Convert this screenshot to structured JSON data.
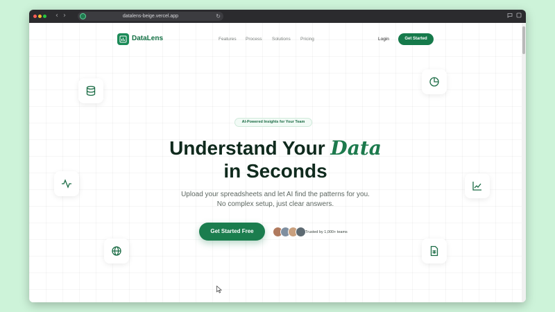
{
  "browser": {
    "url": "datalens-beige.vercel.app"
  },
  "nav": {
    "brand": "DataLens",
    "links": [
      "Features",
      "Process",
      "Solutions",
      "Pricing"
    ],
    "login": "Login",
    "cta": "Get Started"
  },
  "hero": {
    "badge": "AI-Powered Insights for Your Team",
    "title_part1": "Understand Your",
    "title_accent": "Data",
    "title_part2": "in Seconds",
    "subtitle": "Upload your spreadsheets and let AI find the patterns for you. No complex setup, just clear answers.",
    "cta": "Get Started Free",
    "trust": "Trusted by 1,000+ teams"
  },
  "floating_icons": [
    "database-icon",
    "pie-chart-icon",
    "activity-icon",
    "line-chart-icon",
    "globe-icon",
    "spreadsheet-icon"
  ],
  "colors": {
    "brand": "#1b7d4e",
    "accent_text": "#1d7a4d",
    "desktop_bg": "#cdf3d9",
    "heading": "#0f2a1d"
  }
}
